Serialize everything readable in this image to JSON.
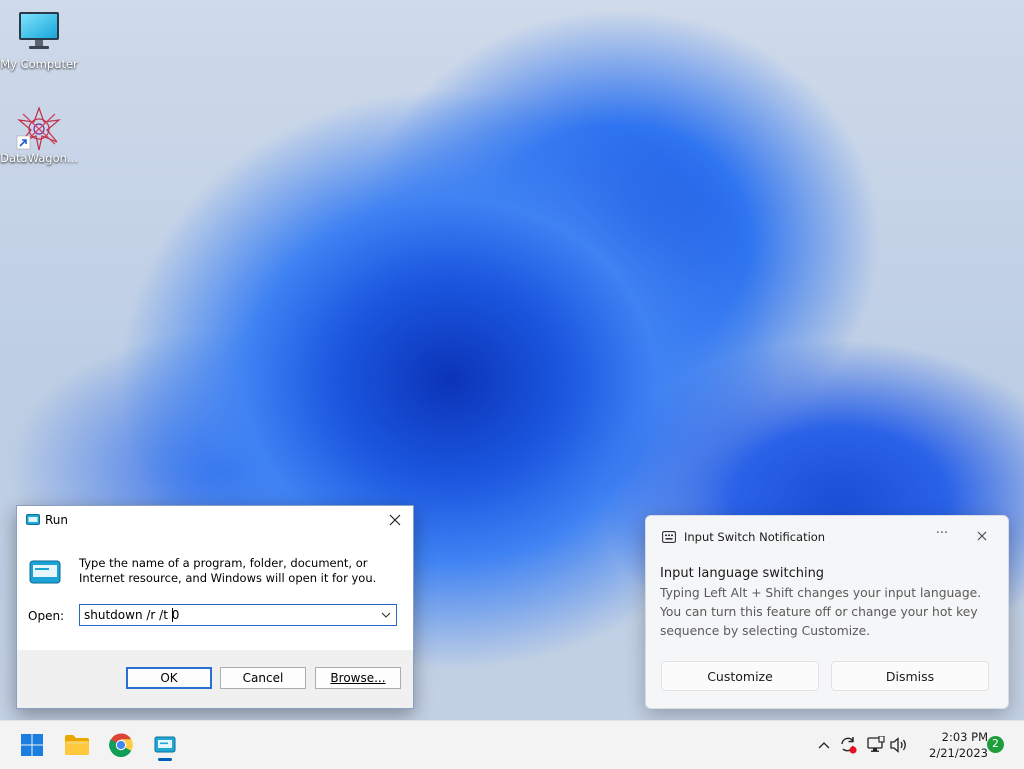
{
  "desktop": {
    "icons": [
      {
        "label": "My Computer",
        "icon": "monitor-icon"
      },
      {
        "label": "DataWagon...",
        "icon": "datawagon-icon"
      }
    ]
  },
  "run_dialog": {
    "title": "Run",
    "description": "Type the name of a program, folder, document, or Internet resource, and Windows will open it for you.",
    "open_label": "Open:",
    "command_value": "shutdown /r /t 0",
    "buttons": {
      "ok": "OK",
      "cancel": "Cancel",
      "browse": "Browse..."
    }
  },
  "notification": {
    "app_name": "Input Switch Notification",
    "more_label": "···",
    "heading": "Input language switching",
    "message": "Typing Left Alt + Shift changes your input language. You can turn this feature off or change your hot key sequence by selecting Customize.",
    "buttons": {
      "customize": "Customize",
      "dismiss": "Dismiss"
    }
  },
  "taskbar": {
    "apps": [
      "start-icon",
      "file-explorer-icon",
      "chrome-icon",
      "run-icon"
    ],
    "tray": [
      "chevron-up-icon",
      "sync-alert-icon",
      "network-icon",
      "volume-icon"
    ],
    "time": "2:03 PM",
    "date": "2/21/2023",
    "notification_count": "2"
  },
  "colors": {
    "accent": "#005fb8",
    "badge": "#1e9e3a",
    "focus_border": "#2968c8"
  }
}
